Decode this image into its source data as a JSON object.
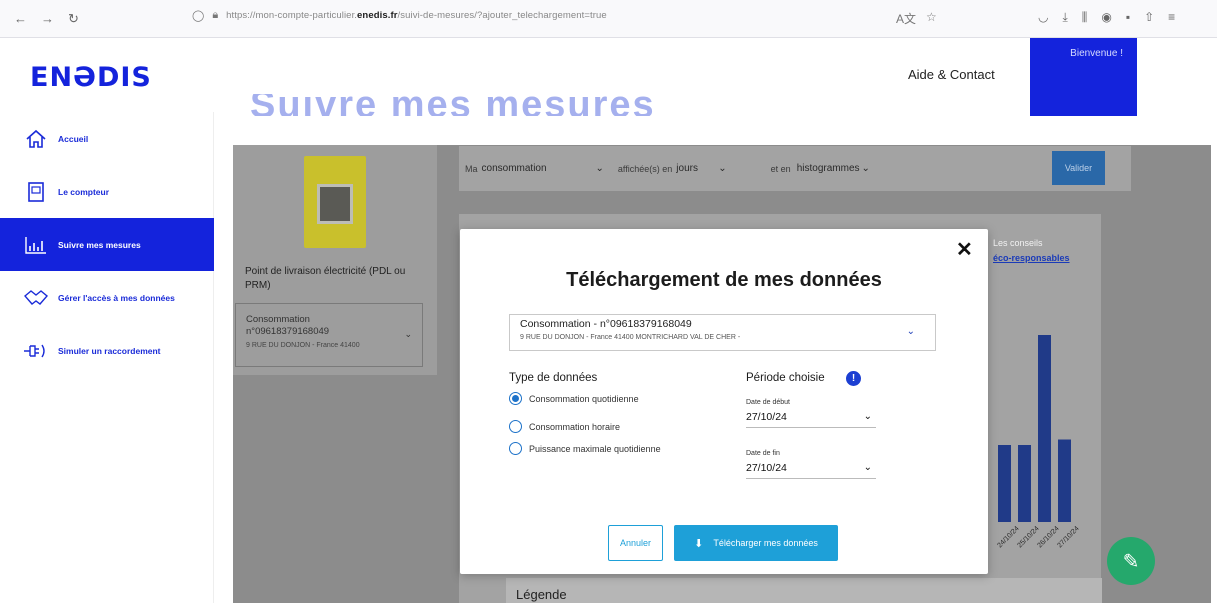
{
  "browser": {
    "url_prefix": "https://mon-compte-particulier.",
    "url_domain": "enedis.fr",
    "url_suffix": "/suivi-de-mesures/?ajouter_telechargement=true"
  },
  "header": {
    "logo": "ENƏDIS",
    "aide_contact": "Aide & Contact",
    "bienvenue": "Bienvenue !",
    "page_title": "Suivre mes mesures"
  },
  "sidebar": {
    "items": [
      {
        "label": "Accueil",
        "icon": "home-icon"
      },
      {
        "label": "Le compteur",
        "icon": "meter-icon"
      },
      {
        "label": "Suivre mes mesures",
        "icon": "bar-chart-icon"
      },
      {
        "label": "Gérer l'accès à mes données",
        "icon": "handshake-icon"
      },
      {
        "label": "Simuler un raccordement",
        "icon": "plug-icon"
      }
    ],
    "active_index": 2
  },
  "left_panel": {
    "pdl_label": "Point de livraison électricité (PDL ou PRM)",
    "conso_line1": "Consommation",
    "conso_line2": "n°09618379168049",
    "conso_address": "9 RUE DU DONJON - France 41400"
  },
  "filters": {
    "ma_label": "Ma",
    "ma_value": "consommation",
    "affichee_label": "affichée(s) en",
    "affichee_value": "jours",
    "eten_label": "et en",
    "eten_value": "histogrammes",
    "valider": "Valider"
  },
  "conseils": {
    "line1": "Les conseils",
    "line2": "éco-responsables"
  },
  "chart_data": {
    "type": "bar",
    "categories": [
      "24/10/24",
      "25/10/24",
      "26/10/24",
      "27/10/24"
    ],
    "values": [
      1.4,
      1.4,
      3.4,
      1.5
    ],
    "ylim": [
      0,
      4
    ]
  },
  "legende": "Légende",
  "modal": {
    "title": "Téléchargement de mes données",
    "select_line1": "Consommation - n°09618379168049",
    "select_line2": "9 RUE DU DONJON - France 41400 MONTRICHARD VAL DE CHER -",
    "type_label": "Type de données",
    "radios": [
      {
        "label": "Consommation quotidienne",
        "checked": true
      },
      {
        "label": "Consommation horaire",
        "checked": false
      },
      {
        "label": "Puissance maximale quotidienne",
        "checked": false
      }
    ],
    "periode_label": "Période choisie",
    "date_debut_label": "Date de début",
    "date_debut_value": "27/10/24",
    "date_fin_label": "Date de fin",
    "date_fin_value": "27/10/24",
    "cancel": "Annuler",
    "download": "Télécharger mes données"
  }
}
